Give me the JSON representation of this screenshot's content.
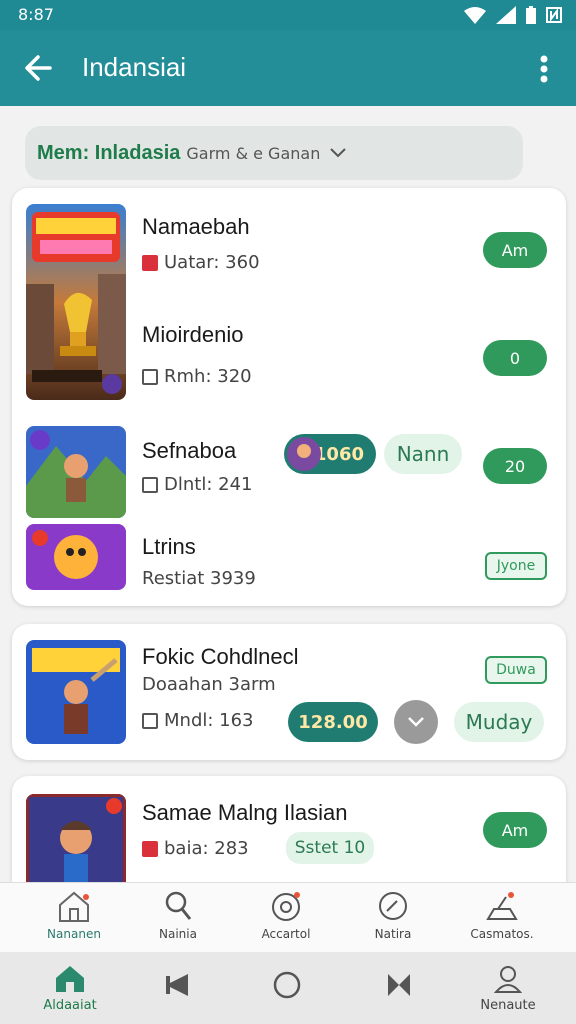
{
  "status": {
    "time": "8:87"
  },
  "appbar": {
    "title": "Indansiai"
  },
  "filter": {
    "bold": "Mem: Inladasia",
    "rest": "Garm & e Ganan"
  },
  "card1": {
    "games": [
      {
        "name": "Namaebah",
        "meta": "Uatar: 360",
        "button": "Am"
      },
      {
        "name": "Mioirdenio",
        "meta": "Rmh: 320",
        "price": "1060",
        "chip": "Nann",
        "button": "0"
      },
      {
        "name": "Sefnaboa",
        "meta": "Dlntl: 241",
        "button": "20"
      },
      {
        "name": "Ltrins",
        "meta": "Restiat 3939",
        "button": "Jyone"
      }
    ]
  },
  "card2": {
    "name": "Fokic Cohdlnecl",
    "sub": "Doaahan 3arm",
    "meta": "Mndl: 163",
    "price": "128.00",
    "chip": "Muday",
    "button": "Duwa"
  },
  "card3": {
    "name": "Samae Malng Ilasian",
    "meta": "baia: 283",
    "badge": "Sstet 10",
    "button": "Am"
  },
  "tabs": [
    {
      "label": "Nananen",
      "icon": "store-icon"
    },
    {
      "label": "Nainia",
      "icon": "search-person-icon"
    },
    {
      "label": "Accartol",
      "icon": "target-icon"
    },
    {
      "label": "Natira",
      "icon": "compass-icon"
    },
    {
      "label": "Casmatos.",
      "icon": "settings-icon"
    }
  ],
  "nav": [
    {
      "label": "Aldaaiat",
      "icon": "home-icon"
    },
    {
      "label": "",
      "icon": "back-triangle-icon"
    },
    {
      "label": "",
      "icon": "circle-home-icon"
    },
    {
      "label": "",
      "icon": "recents-icon"
    },
    {
      "label": "Nenaute",
      "icon": "profile-icon"
    }
  ]
}
